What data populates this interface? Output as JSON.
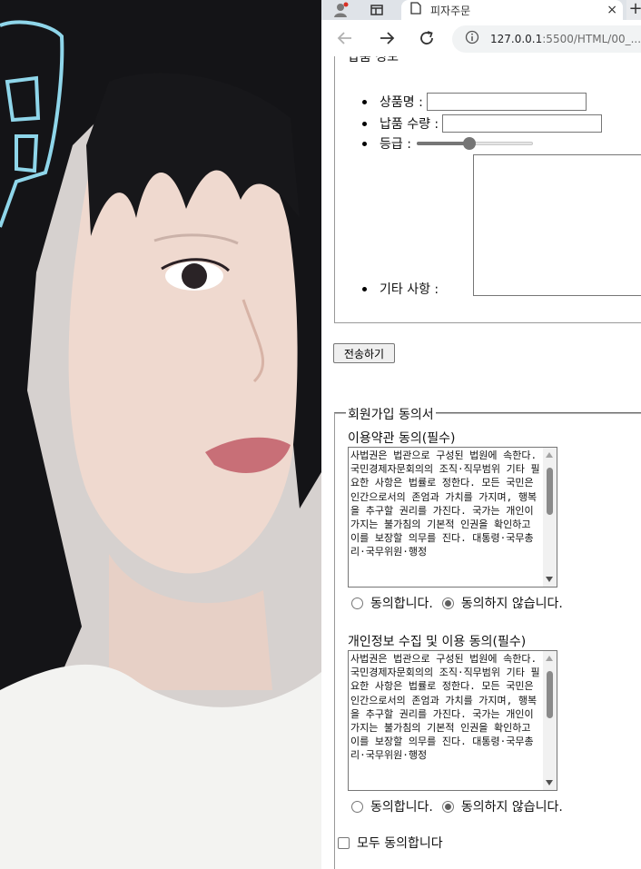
{
  "browser": {
    "tab_title": "피자주문",
    "tab_close": "×",
    "new_tab": "+",
    "url_host": "127.0.0.1",
    "url_path": ":5500/HTML/00_..."
  },
  "delivery": {
    "legend": "납품 정보",
    "product_name_label": "상품명 :",
    "product_name_value": "",
    "quantity_label": "납품 수량 :",
    "quantity_value": "",
    "grade_label": "등급 :",
    "grade_level": 0.45,
    "etc_label": "기타 사항 :",
    "etc_value": ""
  },
  "submit_label": "전송하기",
  "consent": {
    "legend": "회원가입 동의서",
    "terms_title": "이용약관 동의(필수)",
    "terms_text": "사법권은 법관으로 구성된 법원에 속한다. 국민경제자문회의의 조직·직무범위 기타 필요한 사항은 법률로 정한다. 모든 국민은 인간으로서의 존엄과 가치를 가지며, 행복을 추구할 권리를 가진다. 국가는 개인이 가지는 불가침의 기본적 인권을 확인하고 이를 보장할 의무를 진다. 대통령·국무총리·국무위원·행정",
    "privacy_title": "개인정보 수집 및 이용 동의(필수)",
    "privacy_text": "사법권은 법관으로 구성된 법원에 속한다. 국민경제자문회의의 조직·직무범위 기타 필요한 사항은 법률로 정한다. 모든 국민은 인간으로서의 존엄과 가치를 가지며, 행복을 추구할 권리를 가진다. 국가는 개인이 가지는 불가침의 기본적 인권을 확인하고 이를 보장할 의무를 진다. 대통령·국무총리·국무위원·행정",
    "agree_label": "동의합니다.",
    "disagree_label": "동의하지 않습니다.",
    "all_agree_label": "모두 동의합니다"
  }
}
